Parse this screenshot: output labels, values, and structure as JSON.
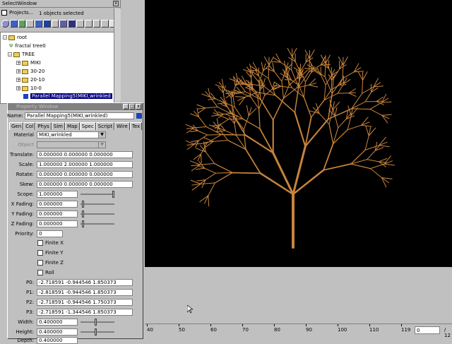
{
  "select_window": {
    "title": "SelectWindow",
    "projects_label": "Projects...",
    "selection_status": "1 objects selected",
    "tree": [
      {
        "label": "root",
        "indent": 0,
        "icon": "folder-icon"
      },
      {
        "label": "fractal tree0",
        "indent": 1,
        "icon": "tree-icon"
      },
      {
        "label": "TREE",
        "indent": 1,
        "icon": "folder-icon",
        "expanded": true
      },
      {
        "label": "MIKI",
        "indent": 2,
        "icon": "folder-icon"
      },
      {
        "label": "30-20",
        "indent": 2,
        "icon": "folder-icon"
      },
      {
        "label": "20-10",
        "indent": 2,
        "icon": "folder-icon"
      },
      {
        "label": "10-0",
        "indent": 2,
        "icon": "folder-icon"
      },
      {
        "label": "Parallel Mapping5(MIKI,wrinkled",
        "indent": 2,
        "icon": "mapping-icon",
        "selected": true
      }
    ]
  },
  "property_window": {
    "title": "Property Window",
    "name_label": "Name:",
    "name_value": "Parallel Mapping5(MIKI,wrinkled)",
    "tabs": [
      "Gen",
      "Col",
      "Phys",
      "Sim",
      "Map",
      "Spec",
      "Script",
      "Wire",
      "Tex"
    ],
    "active_tab": "Spec",
    "material_label": "Material",
    "material_value": "MIKI,wrinkled",
    "object_label": "Object",
    "object_value": "",
    "translate_label": "Translate:",
    "translate_value": "0.000000 0.000000 0.000000",
    "scale_label": "Scale:",
    "scale_value": "1.000000 2.000000 1.000000",
    "rotate_label": "Rotate:",
    "rotate_value": "0.000000 0.000000 0.000000",
    "skew_label": "Skew:",
    "skew_value": "0.000000 0.000000 0.000000",
    "scope_label": "Scope:",
    "scope_value": "1.000000",
    "xfading_label": "X Fading:",
    "xfading_value": "0.000000",
    "yfading_label": "Y Fading:",
    "yfading_value": "0.000000",
    "zfading_label": "Z Fading:",
    "zfading_value": "0.000000",
    "priority_label": "Priority:",
    "priority_value": "0",
    "finite_x": "Finite X",
    "finite_y": "Finite Y",
    "finite_z": "Finite Z",
    "roll": "Roll",
    "p0_label": "P0:",
    "p0_value": "-2.718591 -0.944546 1.850373",
    "p1_label": "P1:",
    "p1_value": "-2.818591 -0.944546 1.850373",
    "p2_label": "P2:",
    "p2_value": "-2.718591 -0.944546 1.750373",
    "p3_label": "P3:",
    "p3_value": "-2.718591 -1.344546 1.850373",
    "width_label": "Width:",
    "width_value": "0.400000",
    "height_label": "Height:",
    "height_value": "0.400000",
    "depth_label": "Depth:",
    "depth_value": "0.400000"
  },
  "timeline": {
    "ticks": [
      "40",
      "50",
      "60",
      "70",
      "80",
      "90",
      "100",
      "110",
      "119"
    ],
    "current_frame": "0",
    "total_frames": "/ 12"
  },
  "colors": {
    "viewport_bg": "#000000",
    "tree_color": "#c8843c",
    "selection": "#000080"
  }
}
